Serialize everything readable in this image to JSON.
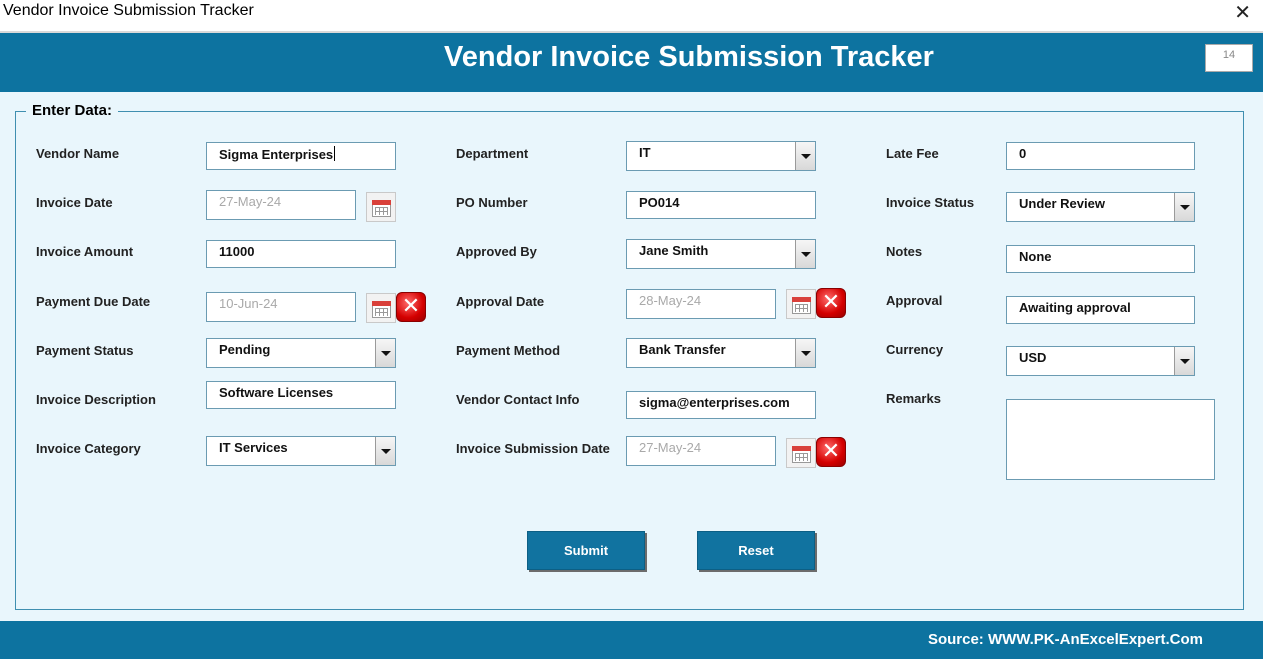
{
  "window": {
    "title": "Vendor Invoice Submission Tracker",
    "close_glyph": "✕"
  },
  "header": {
    "title": "Vendor Invoice Submission Tracker",
    "record_number": "14"
  },
  "form": {
    "legend": "Enter Data:",
    "vendor_name": {
      "label": "Vendor Name",
      "value": "Sigma Enterprises"
    },
    "invoice_date": {
      "label": "Invoice Date",
      "value": "27-May-24"
    },
    "invoice_amount": {
      "label": "Invoice Amount",
      "value": "11000"
    },
    "payment_due_date": {
      "label": "Payment Due Date",
      "value": "10-Jun-24"
    },
    "payment_status": {
      "label": "Payment Status",
      "value": "Pending"
    },
    "invoice_description": {
      "label": "Invoice Description",
      "value": "Software Licenses"
    },
    "invoice_category": {
      "label": "Invoice Category",
      "value": "IT Services"
    },
    "department": {
      "label": "Department",
      "value": "IT"
    },
    "po_number": {
      "label": "PO Number",
      "value": "PO014"
    },
    "approved_by": {
      "label": "Approved By",
      "value": "Jane Smith"
    },
    "approval_date": {
      "label": "Approval Date",
      "value": "28-May-24"
    },
    "payment_method": {
      "label": "Payment Method",
      "value": "Bank Transfer"
    },
    "vendor_contact_info": {
      "label": "Vendor Contact Info",
      "value": "sigma@enterprises.com"
    },
    "invoice_submission_date": {
      "label": "Invoice Submission Date",
      "value": "27-May-24"
    },
    "late_fee": {
      "label": "Late Fee",
      "value": "0"
    },
    "invoice_status": {
      "label": "Invoice Status",
      "value": "Under Review"
    },
    "notes": {
      "label": "Notes",
      "value": "None"
    },
    "approval": {
      "label": "Approval",
      "value": "Awaiting approval"
    },
    "currency": {
      "label": "Currency",
      "value": "USD"
    },
    "remarks": {
      "label": "Remarks",
      "value": ""
    }
  },
  "buttons": {
    "submit": "Submit",
    "reset": "Reset",
    "clear_glyph": "✕"
  },
  "footer": {
    "source": "Source: WWW.PK-AnExcelExpert.Com"
  },
  "colors": {
    "accent": "#0d73a0",
    "panel_bg": "#e9f6fc"
  },
  "icons": {
    "calendar": "calendar-icon",
    "clear": "clear-date-icon",
    "dropdown": "chevron-down-icon"
  }
}
